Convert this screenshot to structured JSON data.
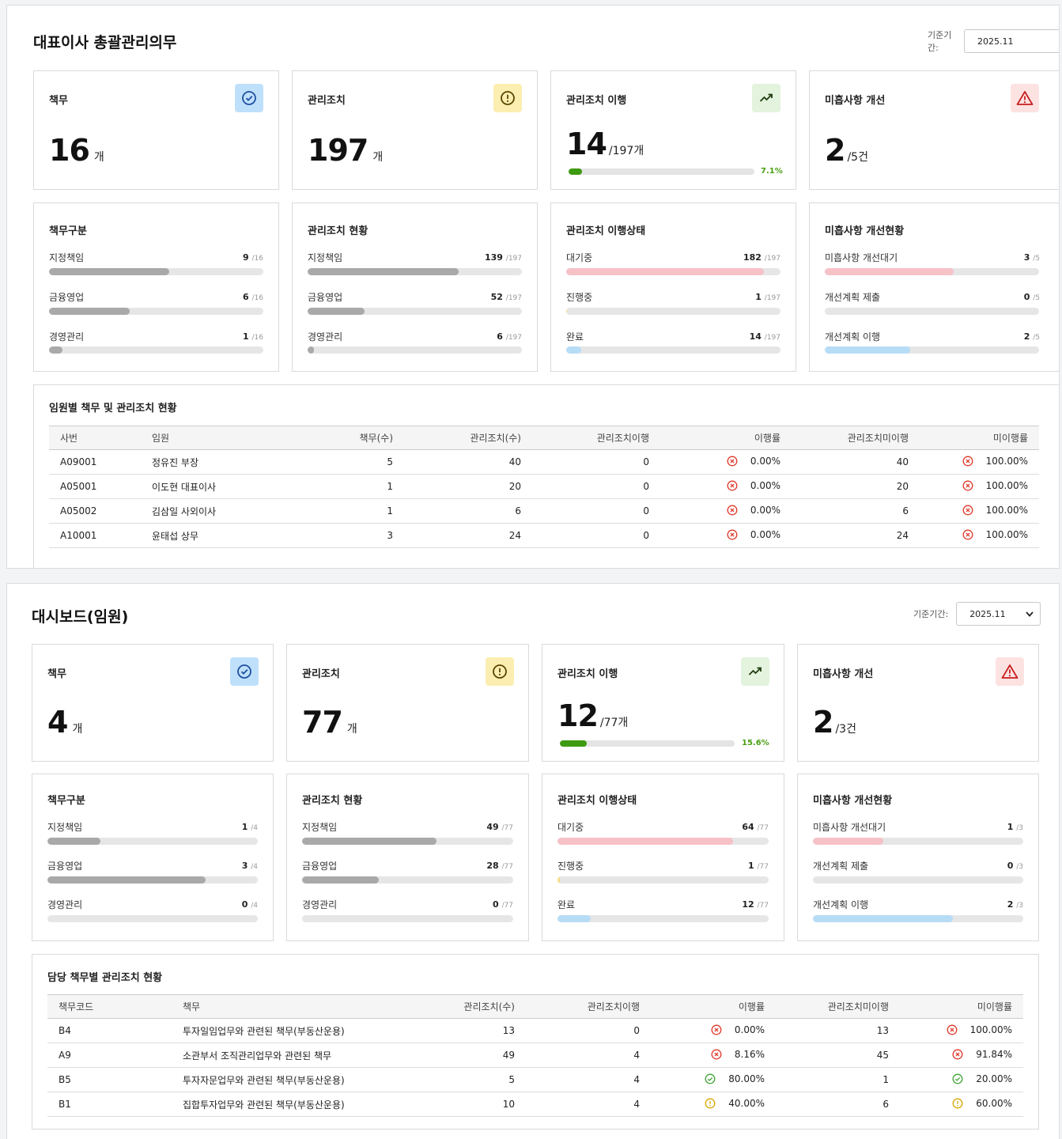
{
  "dash1": {
    "title": "대표이사 총괄관리의무",
    "period_label": "기준기간:",
    "period_value": "2025.11",
    "summary": {
      "duty": {
        "title": "책무",
        "value": "16",
        "unit": "개"
      },
      "action": {
        "title": "관리조치",
        "value": "197",
        "unit": "개"
      },
      "exec": {
        "title": "관리조치 이행",
        "value": "14",
        "unit": "/197개",
        "percent_text": "7.1%",
        "percent": 7.1
      },
      "defect": {
        "title": "미흡사항 개선",
        "value": "2",
        "unit": "/5건"
      }
    },
    "breakdown": {
      "duty": {
        "title": "책무구분",
        "rows": [
          {
            "label": "지정책임",
            "value": "9",
            "total": "/16",
            "fraction": 0.5625,
            "color": "#a9a9a9"
          },
          {
            "label": "금융영업",
            "value": "6",
            "total": "/16",
            "fraction": 0.375,
            "color": "#a9a9a9"
          },
          {
            "label": "경영관리",
            "value": "1",
            "total": "/16",
            "fraction": 0.0625,
            "color": "#a9a9a9"
          }
        ]
      },
      "action": {
        "title": "관리조치 현황",
        "rows": [
          {
            "label": "지정책임",
            "value": "139",
            "total": "/197",
            "fraction": 0.7056,
            "color": "#a9a9a9"
          },
          {
            "label": "금융영업",
            "value": "52",
            "total": "/197",
            "fraction": 0.264,
            "color": "#a9a9a9"
          },
          {
            "label": "경영관리",
            "value": "6",
            "total": "/197",
            "fraction": 0.0305,
            "color": "#a9a9a9"
          }
        ]
      },
      "exec": {
        "title": "관리조치 이행상태",
        "rows": [
          {
            "label": "대기중",
            "value": "182",
            "total": "/197",
            "fraction": 0.9239,
            "color": "#f7c1c8"
          },
          {
            "label": "진행중",
            "value": "1",
            "total": "/197",
            "fraction": 0.0051,
            "color": "#f5e08a"
          },
          {
            "label": "완료",
            "value": "14",
            "total": "/197",
            "fraction": 0.0711,
            "color": "#b7dcf6"
          }
        ]
      },
      "defect": {
        "title": "미흡사항 개선현황",
        "rows": [
          {
            "label": "미흡사항 개선대기",
            "value": "3",
            "total": "/5",
            "fraction": 0.6,
            "color": "#f7c1c8"
          },
          {
            "label": "개선계획 제출",
            "value": "0",
            "total": "/5",
            "fraction": 0,
            "color": "#f5e08a"
          },
          {
            "label": "개선계획 이행",
            "value": "2",
            "total": "/5",
            "fraction": 0.4,
            "color": "#b7dcf6"
          }
        ]
      }
    },
    "table": {
      "title": "임원별 책무 및 관리조치 현황",
      "headers": [
        "사번",
        "임원",
        "책무(수)",
        "관리조치(수)",
        "관리조치이행",
        "이행률",
        "관리조치미이행",
        "미이행률"
      ],
      "rows": [
        {
          "c0": "A09001",
          "c1": "정유진 부장",
          "c2": "5",
          "c3": "40",
          "c4": "0",
          "rate": "0.00%",
          "rate_status": "bad",
          "c6": "40",
          "unrate": "100.00%",
          "unrate_status": "bad"
        },
        {
          "c0": "A05001",
          "c1": "이도현 대표이사",
          "c2": "1",
          "c3": "20",
          "c4": "0",
          "rate": "0.00%",
          "rate_status": "bad",
          "c6": "20",
          "unrate": "100.00%",
          "unrate_status": "bad"
        },
        {
          "c0": "A05002",
          "c1": "김삼일 사외이사",
          "c2": "1",
          "c3": "6",
          "c4": "0",
          "rate": "0.00%",
          "rate_status": "bad",
          "c6": "6",
          "unrate": "100.00%",
          "unrate_status": "bad"
        },
        {
          "c0": "A10001",
          "c1": "윤태섭 상무",
          "c2": "3",
          "c3": "24",
          "c4": "0",
          "rate": "0.00%",
          "rate_status": "bad",
          "c6": "24",
          "unrate": "100.00%",
          "unrate_status": "bad"
        }
      ]
    }
  },
  "dash2": {
    "title": "대시보드(임원)",
    "period_label": "기준기간:",
    "period_value": "2025.11",
    "summary": {
      "duty": {
        "title": "책무",
        "value": "4",
        "unit": "개"
      },
      "action": {
        "title": "관리조치",
        "value": "77",
        "unit": "개"
      },
      "exec": {
        "title": "관리조치 이행",
        "value": "12",
        "unit": "/77개",
        "percent_text": "15.6%",
        "percent": 15.6
      },
      "defect": {
        "title": "미흡사항 개선",
        "value": "2",
        "unit": "/3건"
      }
    },
    "breakdown": {
      "duty": {
        "title": "책무구분",
        "rows": [
          {
            "label": "지정책임",
            "value": "1",
            "total": "/4",
            "fraction": 0.25,
            "color": "#a9a9a9"
          },
          {
            "label": "금융영업",
            "value": "3",
            "total": "/4",
            "fraction": 0.75,
            "color": "#a9a9a9"
          },
          {
            "label": "경영관리",
            "value": "0",
            "total": "/4",
            "fraction": 0,
            "color": "#a9a9a9"
          }
        ]
      },
      "action": {
        "title": "관리조치 현황",
        "rows": [
          {
            "label": "지정책임",
            "value": "49",
            "total": "/77",
            "fraction": 0.6364,
            "color": "#a9a9a9"
          },
          {
            "label": "금융영업",
            "value": "28",
            "total": "/77",
            "fraction": 0.3636,
            "color": "#a9a9a9"
          },
          {
            "label": "경영관리",
            "value": "0",
            "total": "/77",
            "fraction": 0,
            "color": "#a9a9a9"
          }
        ]
      },
      "exec": {
        "title": "관리조치 이행상태",
        "rows": [
          {
            "label": "대기중",
            "value": "64",
            "total": "/77",
            "fraction": 0.8312,
            "color": "#f7c1c8"
          },
          {
            "label": "진행중",
            "value": "1",
            "total": "/77",
            "fraction": 0.013,
            "color": "#f5e08a"
          },
          {
            "label": "완료",
            "value": "12",
            "total": "/77",
            "fraction": 0.1558,
            "color": "#b7dcf6"
          }
        ]
      },
      "defect": {
        "title": "미흡사항 개선현황",
        "rows": [
          {
            "label": "미흡사항 개선대기",
            "value": "1",
            "total": "/3",
            "fraction": 0.3333,
            "color": "#f7c1c8"
          },
          {
            "label": "개선계획 제출",
            "value": "0",
            "total": "/3",
            "fraction": 0,
            "color": "#f5e08a"
          },
          {
            "label": "개선계획 이행",
            "value": "2",
            "total": "/3",
            "fraction": 0.6667,
            "color": "#b7dcf6"
          }
        ]
      }
    },
    "table": {
      "title": "담당 책무별 관리조치 현황",
      "headers": [
        "책무코드",
        "책무",
        "관리조치(수)",
        "관리조치이행",
        "이행률",
        "관리조치미이행",
        "미이행률"
      ],
      "rows": [
        {
          "c0": "B4",
          "c1": "투자일임업무와 관련된 책무(부동산운용)",
          "c2": "13",
          "c3": "0",
          "rate": "0.00%",
          "rate_status": "bad",
          "c5": "13",
          "unrate": "100.00%",
          "unrate_status": "bad"
        },
        {
          "c0": "A9",
          "c1": "소관부서 조직관리업무와 관련된 책무",
          "c2": "49",
          "c3": "4",
          "rate": "8.16%",
          "rate_status": "bad",
          "c5": "45",
          "unrate": "91.84%",
          "unrate_status": "bad"
        },
        {
          "c0": "B5",
          "c1": "투자자문업무와 관련된 책무(부동산운용)",
          "c2": "5",
          "c3": "4",
          "rate": "80.00%",
          "rate_status": "good",
          "c5": "1",
          "unrate": "20.00%",
          "unrate_status": "good"
        },
        {
          "c0": "B1",
          "c1": "집합투자업무와 관련된 책무(부동산운용)",
          "c2": "10",
          "c3": "4",
          "rate": "40.00%",
          "rate_status": "warn",
          "c5": "6",
          "unrate": "60.00%",
          "unrate_status": "warn"
        }
      ]
    }
  },
  "colors": {
    "bad": "#e0392b",
    "good": "#3fa535",
    "warn": "#d9a400",
    "duty_icon_bg": "#bfe0fb",
    "action_icon_bg": "#fbeeb0",
    "exec_icon_bg": "#e3f3dd",
    "defect_icon_bg": "#fde2e2"
  },
  "icons": {
    "duty": "check-circle-icon",
    "action": "alert-circle-icon",
    "exec": "trending-up-icon",
    "defect": "warning-triangle-icon",
    "x": "x-circle-icon",
    "check": "check-circle-icon",
    "info": "alert-circle-icon"
  }
}
